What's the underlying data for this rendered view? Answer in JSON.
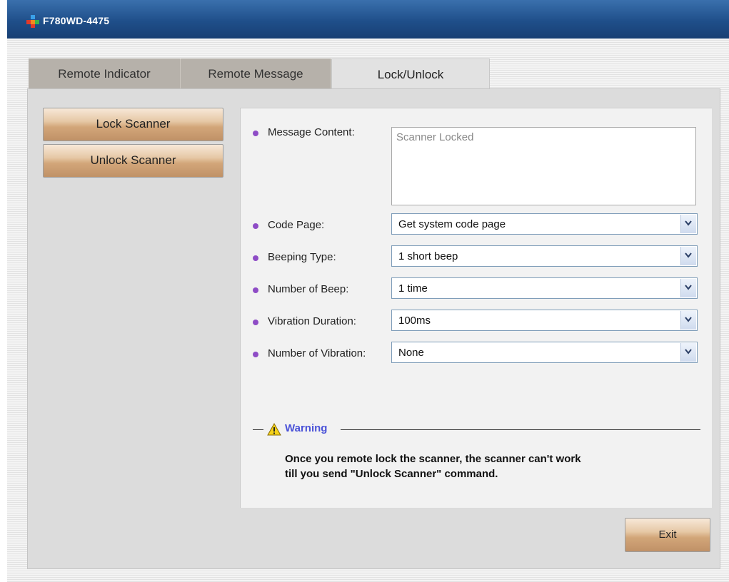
{
  "window": {
    "title": "F780WD-4475"
  },
  "tabs": [
    {
      "label": "Remote Indicator"
    },
    {
      "label": "Remote Message"
    },
    {
      "label": "Lock/Unlock"
    }
  ],
  "sidebar": {
    "lock_label": "Lock Scanner",
    "unlock_label": "Unlock Scanner"
  },
  "form": {
    "message_content": {
      "label": "Message Content:",
      "value": "Scanner Locked"
    },
    "code_page": {
      "label": "Code Page:",
      "value": "Get system code page"
    },
    "beeping_type": {
      "label": "Beeping Type:",
      "value": "1 short beep"
    },
    "number_of_beep": {
      "label": "Number of Beep:",
      "value": "1 time"
    },
    "vibration_duration": {
      "label": "Vibration Duration:",
      "value": "100ms"
    },
    "number_of_vibration": {
      "label": "Number of Vibration:",
      "value": "None"
    }
  },
  "warning": {
    "title": "Warning",
    "line1": "Once you remote lock the scanner, the scanner can't work",
    "line2": "till you send \"Unlock Scanner\" command.",
    "icon": "warning-triangle-icon"
  },
  "footer": {
    "exit_label": "Exit"
  },
  "colors": {
    "titlebar": "#1f4f8a",
    "bullet": "#8e4cc6",
    "warning_title": "#4a52d8",
    "button": "#d2a679"
  }
}
